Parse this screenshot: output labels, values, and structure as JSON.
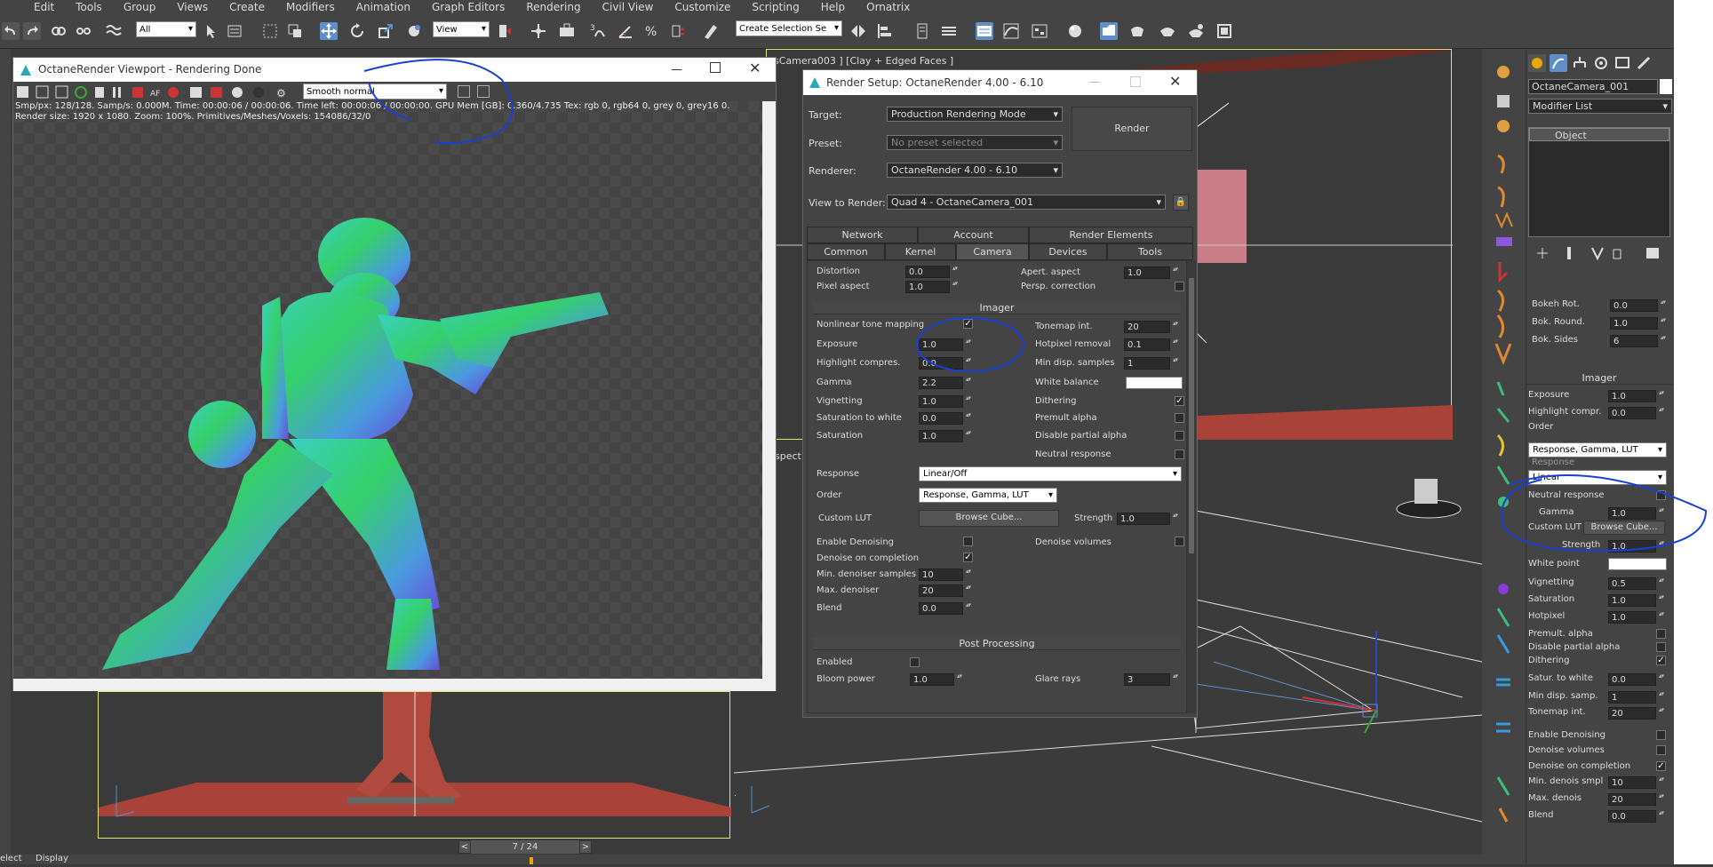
{
  "menu": [
    "Edit",
    "Tools",
    "Group",
    "Views",
    "Create",
    "Modifiers",
    "Animation",
    "Graph Editors",
    "Rendering",
    "Civil View",
    "Customize",
    "Scripting",
    "Help",
    "Ornatrix"
  ],
  "toolbar": {
    "filter_select": "All",
    "ref_coord": "View",
    "selection_set": "Create Selection Se"
  },
  "viewport_top_label": "sCamera003 ] [Clay + Edged Faces ]",
  "viewport_left_label": "spect",
  "timeline": {
    "frame": "7 / 24",
    "prev": "<",
    "next": ">"
  },
  "status_left": [
    "elect",
    "Display"
  ],
  "octane": {
    "title": "OctaneRender Viewport - Rendering Done",
    "render_mode": "Smooth normal",
    "stats_line1": "Smp/px: 128/128.   Samp/s: 0.000M.   Time: 00:00:06 / 00:00:06.   Time left: 00:00:06 / 00:00:00.   GPU Mem [GB]: 0.360/4.735   Tex: rgb 0, rgb64 0, grey 0, grey16 0.",
    "stats_line2": "Render size: 1920 x 1080.   Zoom: 100%.   Primitives/Meshes/Voxels: 154086/32/0"
  },
  "render_setup": {
    "title": "Render Setup: OctaneRender 4.00 - 6.10",
    "target_label": "Target:",
    "target_value": "Production Rendering Mode",
    "preset_label": "Preset:",
    "preset_value": "No preset selected",
    "renderer_label": "Renderer:",
    "renderer_value": "OctaneRender 4.00 - 6.10",
    "view_label": "View to Render:",
    "view_value": "Quad 4 - OctaneCamera_001",
    "render_button": "Render",
    "tabs_row1": [
      "Network",
      "Account",
      "Render Elements"
    ],
    "tabs_row2": [
      "Common",
      "Kernel",
      "Camera",
      "Devices",
      "Tools"
    ],
    "distortion_label": "Distortion",
    "distortion": "0.0",
    "pixel_aspect_label": "Pixel aspect",
    "pixel_aspect": "1.0",
    "apert_aspect_label": "Apert. aspect",
    "apert_aspect": "1.0",
    "persp_corr_label": "Persp. correction",
    "imager_header": "Imager",
    "nonlinear_label": "Nonlinear tone mapping",
    "exposure_label": "Exposure",
    "exposure": "1.0",
    "highlight_label": "Highlight compres.",
    "highlight": "0.0",
    "gamma_label": "Gamma",
    "gamma": "2.2",
    "vignetting_label": "Vignetting",
    "vignetting": "1.0",
    "sat_white_label": "Saturation to white",
    "sat_white": "0.0",
    "saturation_label": "Saturation",
    "saturation": "1.0",
    "tonemap_label": "Tonemap int.",
    "tonemap": "20",
    "hotpixel_label": "Hotpixel removal",
    "hotpixel": "0.1",
    "min_disp_label": "Min disp. samples",
    "min_disp": "1",
    "white_balance_label": "White balance",
    "dithering_label": "Dithering",
    "premult_label": "Premult alpha",
    "disable_partial_label": "Disable partial alpha",
    "neutral_label": "Neutral response",
    "response_label": "Response",
    "response": "Linear/Off",
    "order_label": "Order",
    "order": "Response, Gamma, LUT",
    "custom_lut_label": "Custom LUT",
    "browse_cube": "Browse Cube...",
    "strength_label": "Strength",
    "strength": "1.0",
    "enable_denoise_label": "Enable Denoising",
    "denoise_volumes_label": "Denoise volumes",
    "denoise_completion_label": "Denoise on completion",
    "min_denoiser_label": "Min. denoiser samples",
    "min_denoiser": "10",
    "max_denoiser_label": "Max. denoiser",
    "max_denoiser": "20",
    "blend_label": "Blend",
    "blend": "0.0",
    "post_header": "Post Processing",
    "enabled_label": "Enabled",
    "bloom_label": "Bloom power",
    "bloom": "1.0",
    "glare_label": "Glare rays",
    "glare": "3"
  },
  "cmd_panel": {
    "object_name": "OctaneCamera_001",
    "modifier_list": "Modifier List",
    "stack_item": "Object",
    "bokeh_rot_label": "Bokeh Rot.",
    "bokeh_rot": "0.0",
    "bok_round_label": "Bok. Round.",
    "bok_round": "1.0",
    "bok_sides_label": "Bok. Sides",
    "bok_sides": "6",
    "imager_header": "Imager",
    "exposure_label": "Exposure",
    "exposure": "1.0",
    "highlight_label": "Highlight compr.",
    "highlight": "0.0",
    "order_label": "Order",
    "order": "Response, Gamma, LUT",
    "response_label": "Response",
    "response": "Linear",
    "neutral_label": "Neutral response",
    "gamma_label": "Gamma",
    "gamma": "1.0",
    "custom_lut_label": "Custom LUT",
    "browse_cube": "Browse Cube...",
    "strength_label": "Strength",
    "strength": "1.0",
    "white_point_label": "White point",
    "vignetting_label": "Vignetting",
    "vignetting": "0.5",
    "saturation_label": "Saturation",
    "saturation": "1.0",
    "hotpixel_label": "Hotpixel",
    "hotpixel": "1.0",
    "premult_label": "Premult. alpha",
    "disable_partial_label": "Disable partial alpha",
    "dithering_label": "Dithering",
    "satur_white_label": "Satur. to white",
    "satur_white": "0.0",
    "min_disp_label": "Min disp. samp.",
    "min_disp": "1",
    "tonemap_label": "Tonemap int.",
    "tonemap": "20",
    "enable_denoise_label": "Enable Denoising",
    "denoise_volumes_label": "Denoise volumes",
    "denoise_completion_label": "Denoise on completion",
    "min_denois_label": "Min. denois smpl",
    "min_denois": "10",
    "max_denois_label": "Max. denois",
    "max_denois": "20",
    "blend_label": "Blend",
    "blend": "0.0"
  },
  "colors": {
    "accent": "#5f8fc9",
    "annotation": "#1a3fd6",
    "floor": "#a9433a",
    "character_a": "#35d06a",
    "character_b": "#6a4ad8"
  }
}
